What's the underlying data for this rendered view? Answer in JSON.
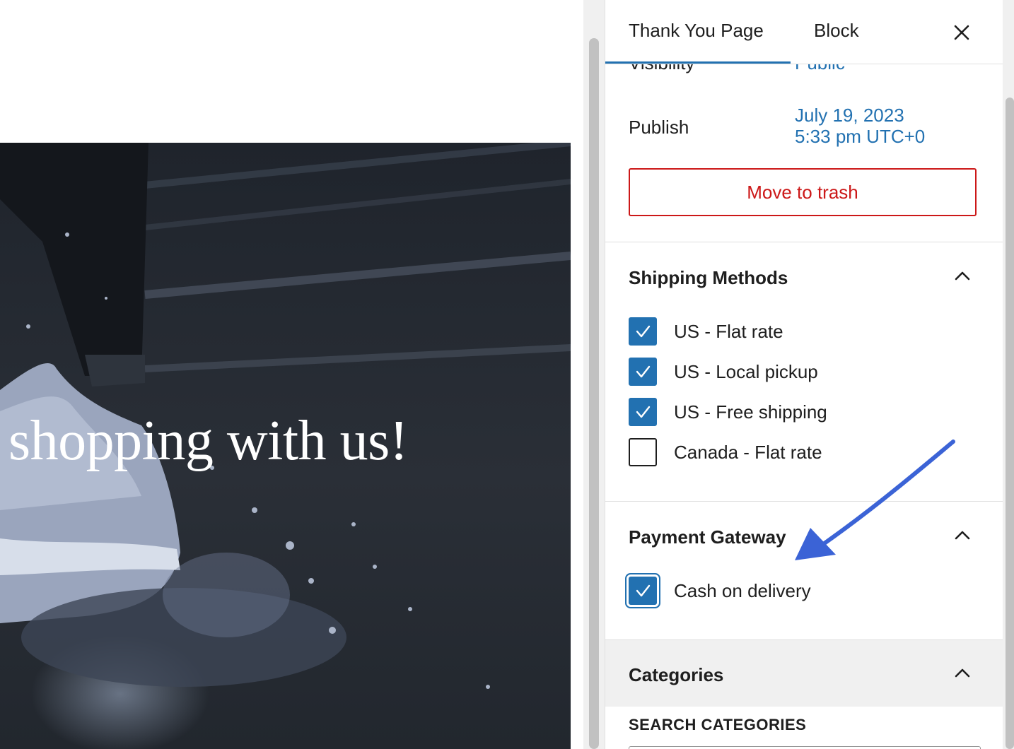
{
  "canvas": {
    "cover_text": "shopping with us!"
  },
  "sidebar": {
    "tabs": [
      {
        "label": "Thank You Page",
        "active": true
      },
      {
        "label": "Block",
        "active": false
      }
    ],
    "close_icon": "close-icon",
    "summary": {
      "visibility_label": "Visibility",
      "visibility_value": "Public",
      "publish_label": "Publish",
      "publish_date_line1": "July 19, 2023",
      "publish_date_line2": "5:33 pm UTC+0",
      "trash_label": "Move to trash"
    },
    "shipping": {
      "title": "Shipping Methods",
      "expanded": true,
      "items": [
        {
          "label": "US - Flat rate",
          "checked": true
        },
        {
          "label": "US - Local pickup",
          "checked": true
        },
        {
          "label": "US - Free shipping",
          "checked": true
        },
        {
          "label": "Canada - Flat rate",
          "checked": false
        }
      ]
    },
    "payment": {
      "title": "Payment Gateway",
      "expanded": true,
      "items": [
        {
          "label": "Cash on delivery",
          "checked": true,
          "focused": true
        }
      ]
    },
    "categories": {
      "title": "Categories",
      "expanded": true,
      "search_label": "SEARCH CATEGORIES"
    }
  },
  "colors": {
    "accent": "#2271b1",
    "danger": "#cc1818",
    "annotation_arrow": "#3b63d6",
    "cover_bg": "#22272e"
  }
}
